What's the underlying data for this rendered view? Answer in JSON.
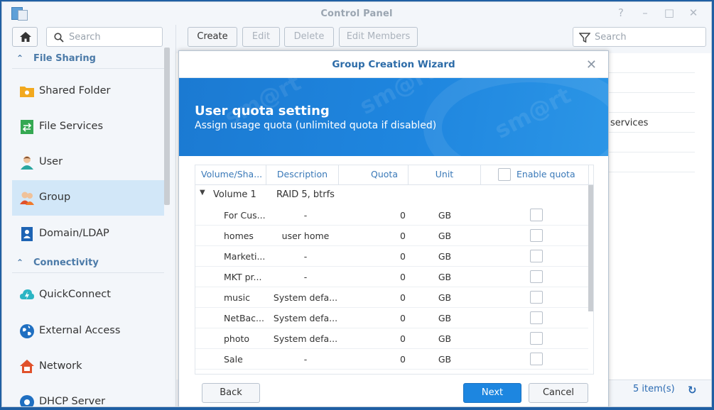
{
  "window": {
    "title": "Control Panel"
  },
  "sidebar": {
    "search_placeholder": "Search",
    "sections": [
      {
        "label": "File Sharing"
      },
      {
        "label": "Connectivity"
      }
    ],
    "items": [
      {
        "label": "Shared Folder",
        "icon": "shared-folder-icon"
      },
      {
        "label": "File Services",
        "icon": "file-services-icon"
      },
      {
        "label": "User",
        "icon": "user-icon"
      },
      {
        "label": "Group",
        "icon": "group-icon",
        "active": true
      },
      {
        "label": "Domain/LDAP",
        "icon": "domain-ldap-icon"
      },
      {
        "label": "QuickConnect",
        "icon": "quickconnect-icon"
      },
      {
        "label": "External Access",
        "icon": "external-access-icon"
      },
      {
        "label": "Network",
        "icon": "network-icon"
      },
      {
        "label": "DHCP Server",
        "icon": "dhcp-server-icon"
      }
    ]
  },
  "toolbar": {
    "create": "Create",
    "edit": "Edit",
    "delete": "Delete",
    "edit_members": "Edit Members",
    "search_placeholder": "Search"
  },
  "main": {
    "partial_cell": "services",
    "item_count": "5 item(s)"
  },
  "wizard": {
    "title": "Group Creation Wizard",
    "heading": "User quota setting",
    "subheading": "Assign usage quota (unlimited quota if disabled)",
    "columns": {
      "volume": "Volume/Sha...",
      "description": "Description",
      "quota": "Quota",
      "unit": "Unit",
      "enable": "Enable quota"
    },
    "group": {
      "name": "Volume 1",
      "description": "RAID 5, btrfs"
    },
    "rows": [
      {
        "name": "For Cus...",
        "description": "-",
        "quota": "0",
        "unit": "GB"
      },
      {
        "name": "homes",
        "description": "user home",
        "quota": "0",
        "unit": "GB"
      },
      {
        "name": "Marketi...",
        "description": "-",
        "quota": "0",
        "unit": "GB"
      },
      {
        "name": "MKT pr...",
        "description": "-",
        "quota": "0",
        "unit": "GB"
      },
      {
        "name": "music",
        "description": "System defa...",
        "quota": "0",
        "unit": "GB"
      },
      {
        "name": "NetBac...",
        "description": "System defa...",
        "quota": "0",
        "unit": "GB"
      },
      {
        "name": "photo",
        "description": "System defa...",
        "quota": "0",
        "unit": "GB"
      },
      {
        "name": "Sale",
        "description": "-",
        "quota": "0",
        "unit": "GB"
      }
    ],
    "buttons": {
      "back": "Back",
      "next": "Next",
      "cancel": "Cancel"
    }
  },
  "colors": {
    "accent": "#1d86e0",
    "banner": "#1b7ad2",
    "section": "#4b7aa8"
  }
}
